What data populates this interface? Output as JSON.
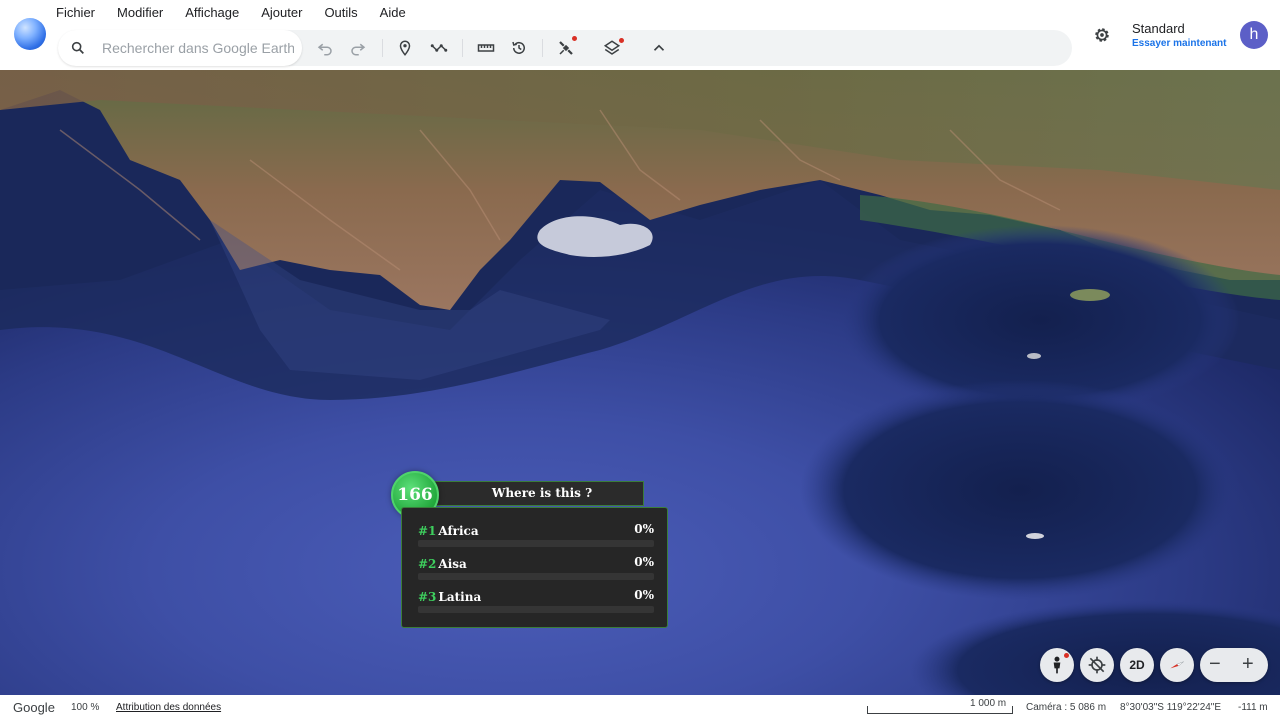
{
  "menu": [
    "Fichier",
    "Modifier",
    "Affichage",
    "Ajouter",
    "Outils",
    "Aide"
  ],
  "search": {
    "placeholder": "Rechercher dans Google Earth"
  },
  "toolbar": {
    "icons": [
      "undo-icon",
      "redo-icon",
      "placemark-icon",
      "path-icon",
      "ruler-icon",
      "history-icon",
      "satellite-icon",
      "layers-icon",
      "chevron-up-icon"
    ]
  },
  "account": {
    "title": "Standard",
    "link": "Essayer maintenant",
    "avatar_letter": "h"
  },
  "poll": {
    "number": "166",
    "title": "Where is this ?",
    "options": [
      {
        "rank": "#1",
        "label": "Africa",
        "percent": "0%",
        "fraction": 0
      },
      {
        "rank": "#2",
        "label": "Aisa",
        "percent": "0%",
        "fraction": 0
      },
      {
        "rank": "#3",
        "label": "Latina",
        "percent": "0%",
        "fraction": 0
      }
    ]
  },
  "controls": {
    "mode_2d": "2D",
    "zoom_out": "−",
    "zoom_in": "+"
  },
  "status": {
    "brand": "Google",
    "zoom": "100 %",
    "attribution": "Attribution des données",
    "scale": "1 000 m",
    "camera": "Caméra : 5 086 m",
    "coords": "8°30'03\"S 119°22'24\"E",
    "altitude": "-111 m"
  },
  "colors": {
    "accent": "#1a73e8",
    "poll_green": "#3ecf5e",
    "avatar": "#5c5fc7"
  }
}
